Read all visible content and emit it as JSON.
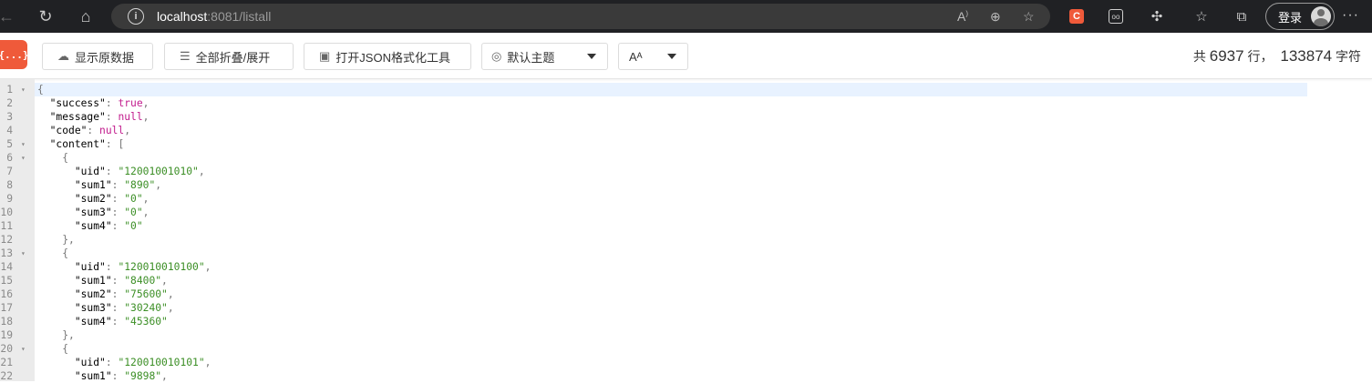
{
  "browser": {
    "url_host": "localhost",
    "url_rest": ":8081/listall",
    "login_label": "登录",
    "ext_c_label": "C"
  },
  "toolbar": {
    "logo_text": "{...}",
    "raw_data_label": "显示原数据",
    "fold_label": "全部折叠/展开",
    "open_tool_label": "打开JSON格式化工具",
    "theme_label": "默认主题",
    "font_label": "Aᴬ",
    "stats": {
      "prefix": "共",
      "lines": "6937",
      "lines_unit": "行，",
      "chars": "133874",
      "chars_unit": "字符"
    }
  },
  "editor": {
    "lines": [
      {
        "n": "1",
        "fold": "▾",
        "tokens": [
          {
            "t": "{",
            "c": "br"
          }
        ]
      },
      {
        "n": "2",
        "fold": "",
        "tokens": [
          {
            "t": "  ",
            "c": "k"
          },
          {
            "t": "\"success\"",
            "c": "k"
          },
          {
            "t": ": ",
            "c": "p"
          },
          {
            "t": "true",
            "c": "b"
          },
          {
            "t": ",",
            "c": "p"
          }
        ]
      },
      {
        "n": "3",
        "fold": "",
        "tokens": [
          {
            "t": "  ",
            "c": "k"
          },
          {
            "t": "\"message\"",
            "c": "k"
          },
          {
            "t": ": ",
            "c": "p"
          },
          {
            "t": "null",
            "c": "n"
          },
          {
            "t": ",",
            "c": "p"
          }
        ]
      },
      {
        "n": "4",
        "fold": "",
        "tokens": [
          {
            "t": "  ",
            "c": "k"
          },
          {
            "t": "\"code\"",
            "c": "k"
          },
          {
            "t": ": ",
            "c": "p"
          },
          {
            "t": "null",
            "c": "n"
          },
          {
            "t": ",",
            "c": "p"
          }
        ]
      },
      {
        "n": "5",
        "fold": "▾",
        "tokens": [
          {
            "t": "  ",
            "c": "k"
          },
          {
            "t": "\"content\"",
            "c": "k"
          },
          {
            "t": ": ",
            "c": "p"
          },
          {
            "t": "[",
            "c": "br"
          }
        ]
      },
      {
        "n": "6",
        "fold": "▾",
        "tokens": [
          {
            "t": "    ",
            "c": "k"
          },
          {
            "t": "{",
            "c": "br"
          }
        ]
      },
      {
        "n": "7",
        "fold": "",
        "tokens": [
          {
            "t": "      ",
            "c": "k"
          },
          {
            "t": "\"uid\"",
            "c": "k"
          },
          {
            "t": ": ",
            "c": "p"
          },
          {
            "t": "\"12001001010\"",
            "c": "s"
          },
          {
            "t": ",",
            "c": "p"
          }
        ]
      },
      {
        "n": "8",
        "fold": "",
        "tokens": [
          {
            "t": "      ",
            "c": "k"
          },
          {
            "t": "\"sum1\"",
            "c": "k"
          },
          {
            "t": ": ",
            "c": "p"
          },
          {
            "t": "\"890\"",
            "c": "s"
          },
          {
            "t": ",",
            "c": "p"
          }
        ]
      },
      {
        "n": "9",
        "fold": "",
        "tokens": [
          {
            "t": "      ",
            "c": "k"
          },
          {
            "t": "\"sum2\"",
            "c": "k"
          },
          {
            "t": ": ",
            "c": "p"
          },
          {
            "t": "\"0\"",
            "c": "s"
          },
          {
            "t": ",",
            "c": "p"
          }
        ]
      },
      {
        "n": "10",
        "fold": "",
        "tokens": [
          {
            "t": "      ",
            "c": "k"
          },
          {
            "t": "\"sum3\"",
            "c": "k"
          },
          {
            "t": ": ",
            "c": "p"
          },
          {
            "t": "\"0\"",
            "c": "s"
          },
          {
            "t": ",",
            "c": "p"
          }
        ]
      },
      {
        "n": "11",
        "fold": "",
        "tokens": [
          {
            "t": "      ",
            "c": "k"
          },
          {
            "t": "\"sum4\"",
            "c": "k"
          },
          {
            "t": ": ",
            "c": "p"
          },
          {
            "t": "\"0\"",
            "c": "s"
          }
        ]
      },
      {
        "n": "12",
        "fold": "",
        "tokens": [
          {
            "t": "    ",
            "c": "k"
          },
          {
            "t": "},",
            "c": "br"
          }
        ]
      },
      {
        "n": "13",
        "fold": "▾",
        "tokens": [
          {
            "t": "    ",
            "c": "k"
          },
          {
            "t": "{",
            "c": "br"
          }
        ]
      },
      {
        "n": "14",
        "fold": "",
        "tokens": [
          {
            "t": "      ",
            "c": "k"
          },
          {
            "t": "\"uid\"",
            "c": "k"
          },
          {
            "t": ": ",
            "c": "p"
          },
          {
            "t": "\"120010010100\"",
            "c": "s"
          },
          {
            "t": ",",
            "c": "p"
          }
        ]
      },
      {
        "n": "15",
        "fold": "",
        "tokens": [
          {
            "t": "      ",
            "c": "k"
          },
          {
            "t": "\"sum1\"",
            "c": "k"
          },
          {
            "t": ": ",
            "c": "p"
          },
          {
            "t": "\"8400\"",
            "c": "s"
          },
          {
            "t": ",",
            "c": "p"
          }
        ]
      },
      {
        "n": "16",
        "fold": "",
        "tokens": [
          {
            "t": "      ",
            "c": "k"
          },
          {
            "t": "\"sum2\"",
            "c": "k"
          },
          {
            "t": ": ",
            "c": "p"
          },
          {
            "t": "\"75600\"",
            "c": "s"
          },
          {
            "t": ",",
            "c": "p"
          }
        ]
      },
      {
        "n": "17",
        "fold": "",
        "tokens": [
          {
            "t": "      ",
            "c": "k"
          },
          {
            "t": "\"sum3\"",
            "c": "k"
          },
          {
            "t": ": ",
            "c": "p"
          },
          {
            "t": "\"30240\"",
            "c": "s"
          },
          {
            "t": ",",
            "c": "p"
          }
        ]
      },
      {
        "n": "18",
        "fold": "",
        "tokens": [
          {
            "t": "      ",
            "c": "k"
          },
          {
            "t": "\"sum4\"",
            "c": "k"
          },
          {
            "t": ": ",
            "c": "p"
          },
          {
            "t": "\"45360\"",
            "c": "s"
          }
        ]
      },
      {
        "n": "19",
        "fold": "",
        "tokens": [
          {
            "t": "    ",
            "c": "k"
          },
          {
            "t": "},",
            "c": "br"
          }
        ]
      },
      {
        "n": "20",
        "fold": "▾",
        "tokens": [
          {
            "t": "    ",
            "c": "k"
          },
          {
            "t": "{",
            "c": "br"
          }
        ]
      },
      {
        "n": "21",
        "fold": "",
        "tokens": [
          {
            "t": "      ",
            "c": "k"
          },
          {
            "t": "\"uid\"",
            "c": "k"
          },
          {
            "t": ": ",
            "c": "p"
          },
          {
            "t": "\"120010010101\"",
            "c": "s"
          },
          {
            "t": ",",
            "c": "p"
          }
        ]
      },
      {
        "n": "22",
        "fold": "",
        "tokens": [
          {
            "t": "      ",
            "c": "k"
          },
          {
            "t": "\"sum1\"",
            "c": "k"
          },
          {
            "t": ": ",
            "c": "p"
          },
          {
            "t": "\"9898\"",
            "c": "s"
          },
          {
            "t": ",",
            "c": "p"
          }
        ]
      }
    ]
  }
}
